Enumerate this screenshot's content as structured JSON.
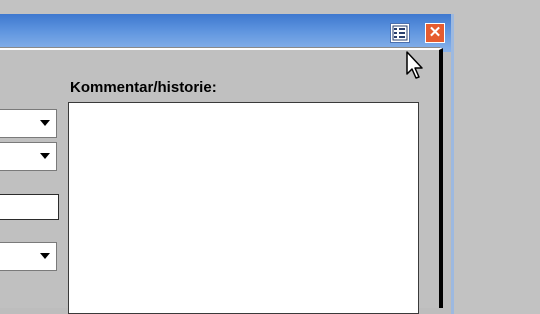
{
  "window": {
    "layout_icon": "layout-grid-icon",
    "close_icon": "close-icon",
    "close_glyph": "✕",
    "titlebar_color": "#3e78cf",
    "close_color": "#e65c2f"
  },
  "form": {
    "dropdowns": [
      {
        "value": "",
        "icon": "chevron-down-icon"
      },
      {
        "value": "",
        "icon": "chevron-down-icon"
      },
      {
        "value": "",
        "icon": "chevron-down-icon"
      }
    ],
    "text_field": {
      "value": ""
    }
  },
  "comment": {
    "label": "Kommentar/historie:",
    "value": ""
  }
}
